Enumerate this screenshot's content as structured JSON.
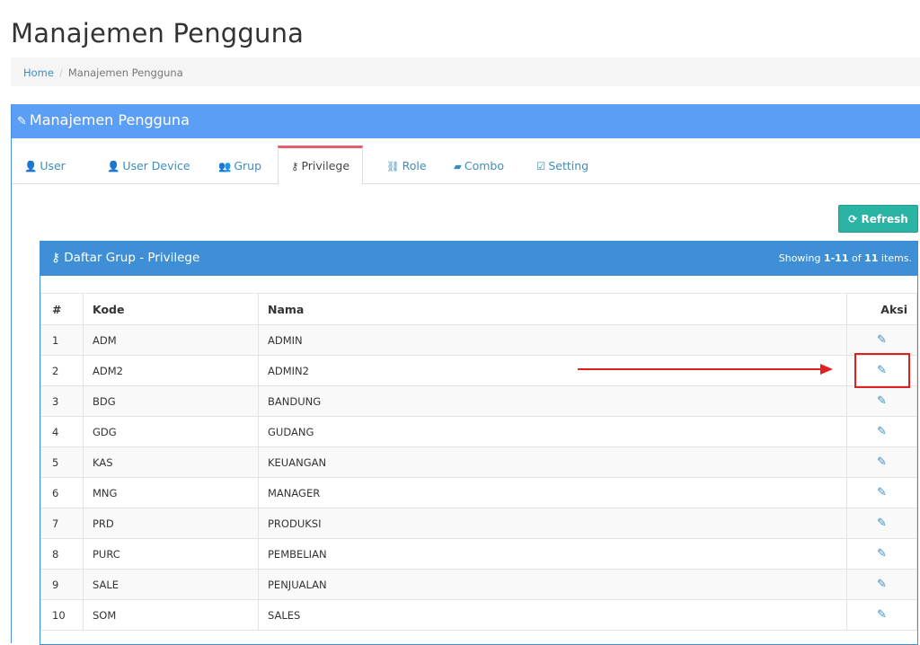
{
  "page": {
    "title": "Manajemen Pengguna"
  },
  "breadcrumb": {
    "home": "Home",
    "separator": "/",
    "current": "Manajemen Pengguna"
  },
  "panel": {
    "title": "Manajemen Pengguna",
    "icon": "pencil-icon",
    "color": "#5b9ef5"
  },
  "tabs": [
    {
      "label": "User",
      "icon": "user-icon",
      "active": false
    },
    {
      "label": "User Device",
      "icon": "user-icon",
      "active": false
    },
    {
      "label": "Grup",
      "icon": "users-icon",
      "active": false
    },
    {
      "label": "Privilege",
      "icon": "key-icon",
      "active": true
    },
    {
      "label": "Role",
      "icon": "sitemap-icon",
      "active": false
    },
    {
      "label": "Combo",
      "icon": "book-icon",
      "active": false
    },
    {
      "label": "Setting",
      "icon": "edit-icon",
      "active": false
    }
  ],
  "toolbar": {
    "refresh_label": "Refresh",
    "refresh_color": "#2bb3a4"
  },
  "grid": {
    "title": "Daftar Grup - Privilege",
    "summary_prefix": "Showing",
    "summary_range": "1-11",
    "summary_of": "of",
    "summary_total": "11",
    "summary_suffix": "items.",
    "header_color": "#3f8fd6",
    "columns": [
      "#",
      "Kode",
      "Nama",
      "Aksi"
    ],
    "rows": [
      {
        "no": "1",
        "kode": "ADM",
        "nama": "ADMIN"
      },
      {
        "no": "2",
        "kode": "ADM2",
        "nama": "ADMIN2"
      },
      {
        "no": "3",
        "kode": "BDG",
        "nama": "BANDUNG"
      },
      {
        "no": "4",
        "kode": "GDG",
        "nama": "GUDANG"
      },
      {
        "no": "5",
        "kode": "KAS",
        "nama": "KEUANGAN"
      },
      {
        "no": "6",
        "kode": "MNG",
        "nama": "MANAGER"
      },
      {
        "no": "7",
        "kode": "PRD",
        "nama": "PRODUKSI"
      },
      {
        "no": "8",
        "kode": "PURC",
        "nama": "PEMBELIAN"
      },
      {
        "no": "9",
        "kode": "SALE",
        "nama": "PENJUALAN"
      },
      {
        "no": "10",
        "kode": "SOM",
        "nama": "SALES"
      }
    ]
  },
  "annotation": {
    "color": "#e02020",
    "target_row": "2"
  }
}
